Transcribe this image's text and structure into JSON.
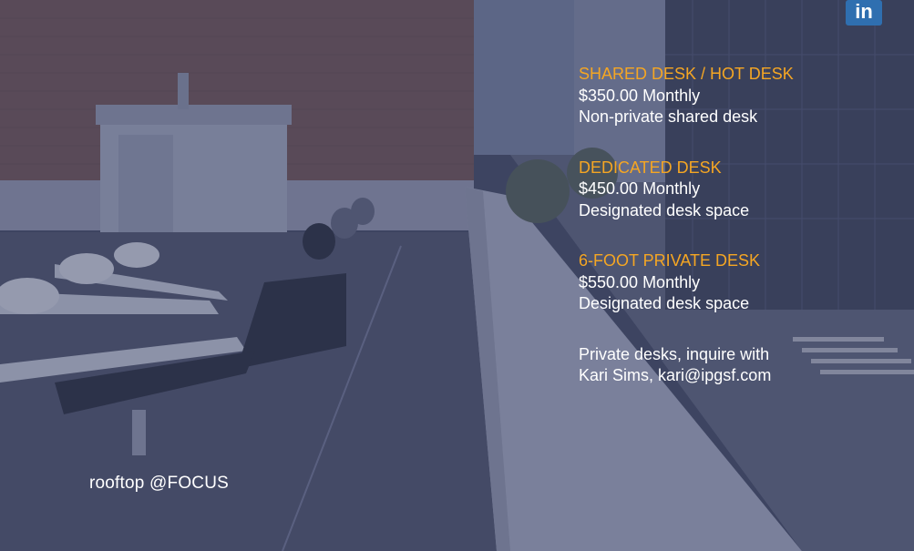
{
  "caption": "rooftop @FOCUS",
  "logo_text": "in",
  "pricing": [
    {
      "name": "SHARED DESK / HOT DESK",
      "price": "$350.00 Monthly",
      "desc": "Non-private shared desk"
    },
    {
      "name": "DEDICATED DESK",
      "price": "$450.00 Monthly",
      "desc": "Designated desk space"
    },
    {
      "name": "6-FOOT PRIVATE DESK",
      "price": "$550.00 Monthly",
      "desc": "Designated desk space"
    }
  ],
  "note": {
    "line1": "Private desks, inquire with",
    "line2": "Kari Sims, kari@ipgsf.com"
  },
  "colors": {
    "accent": "#f5a623",
    "overlay": "#3a4263",
    "text": "#ffffff"
  }
}
